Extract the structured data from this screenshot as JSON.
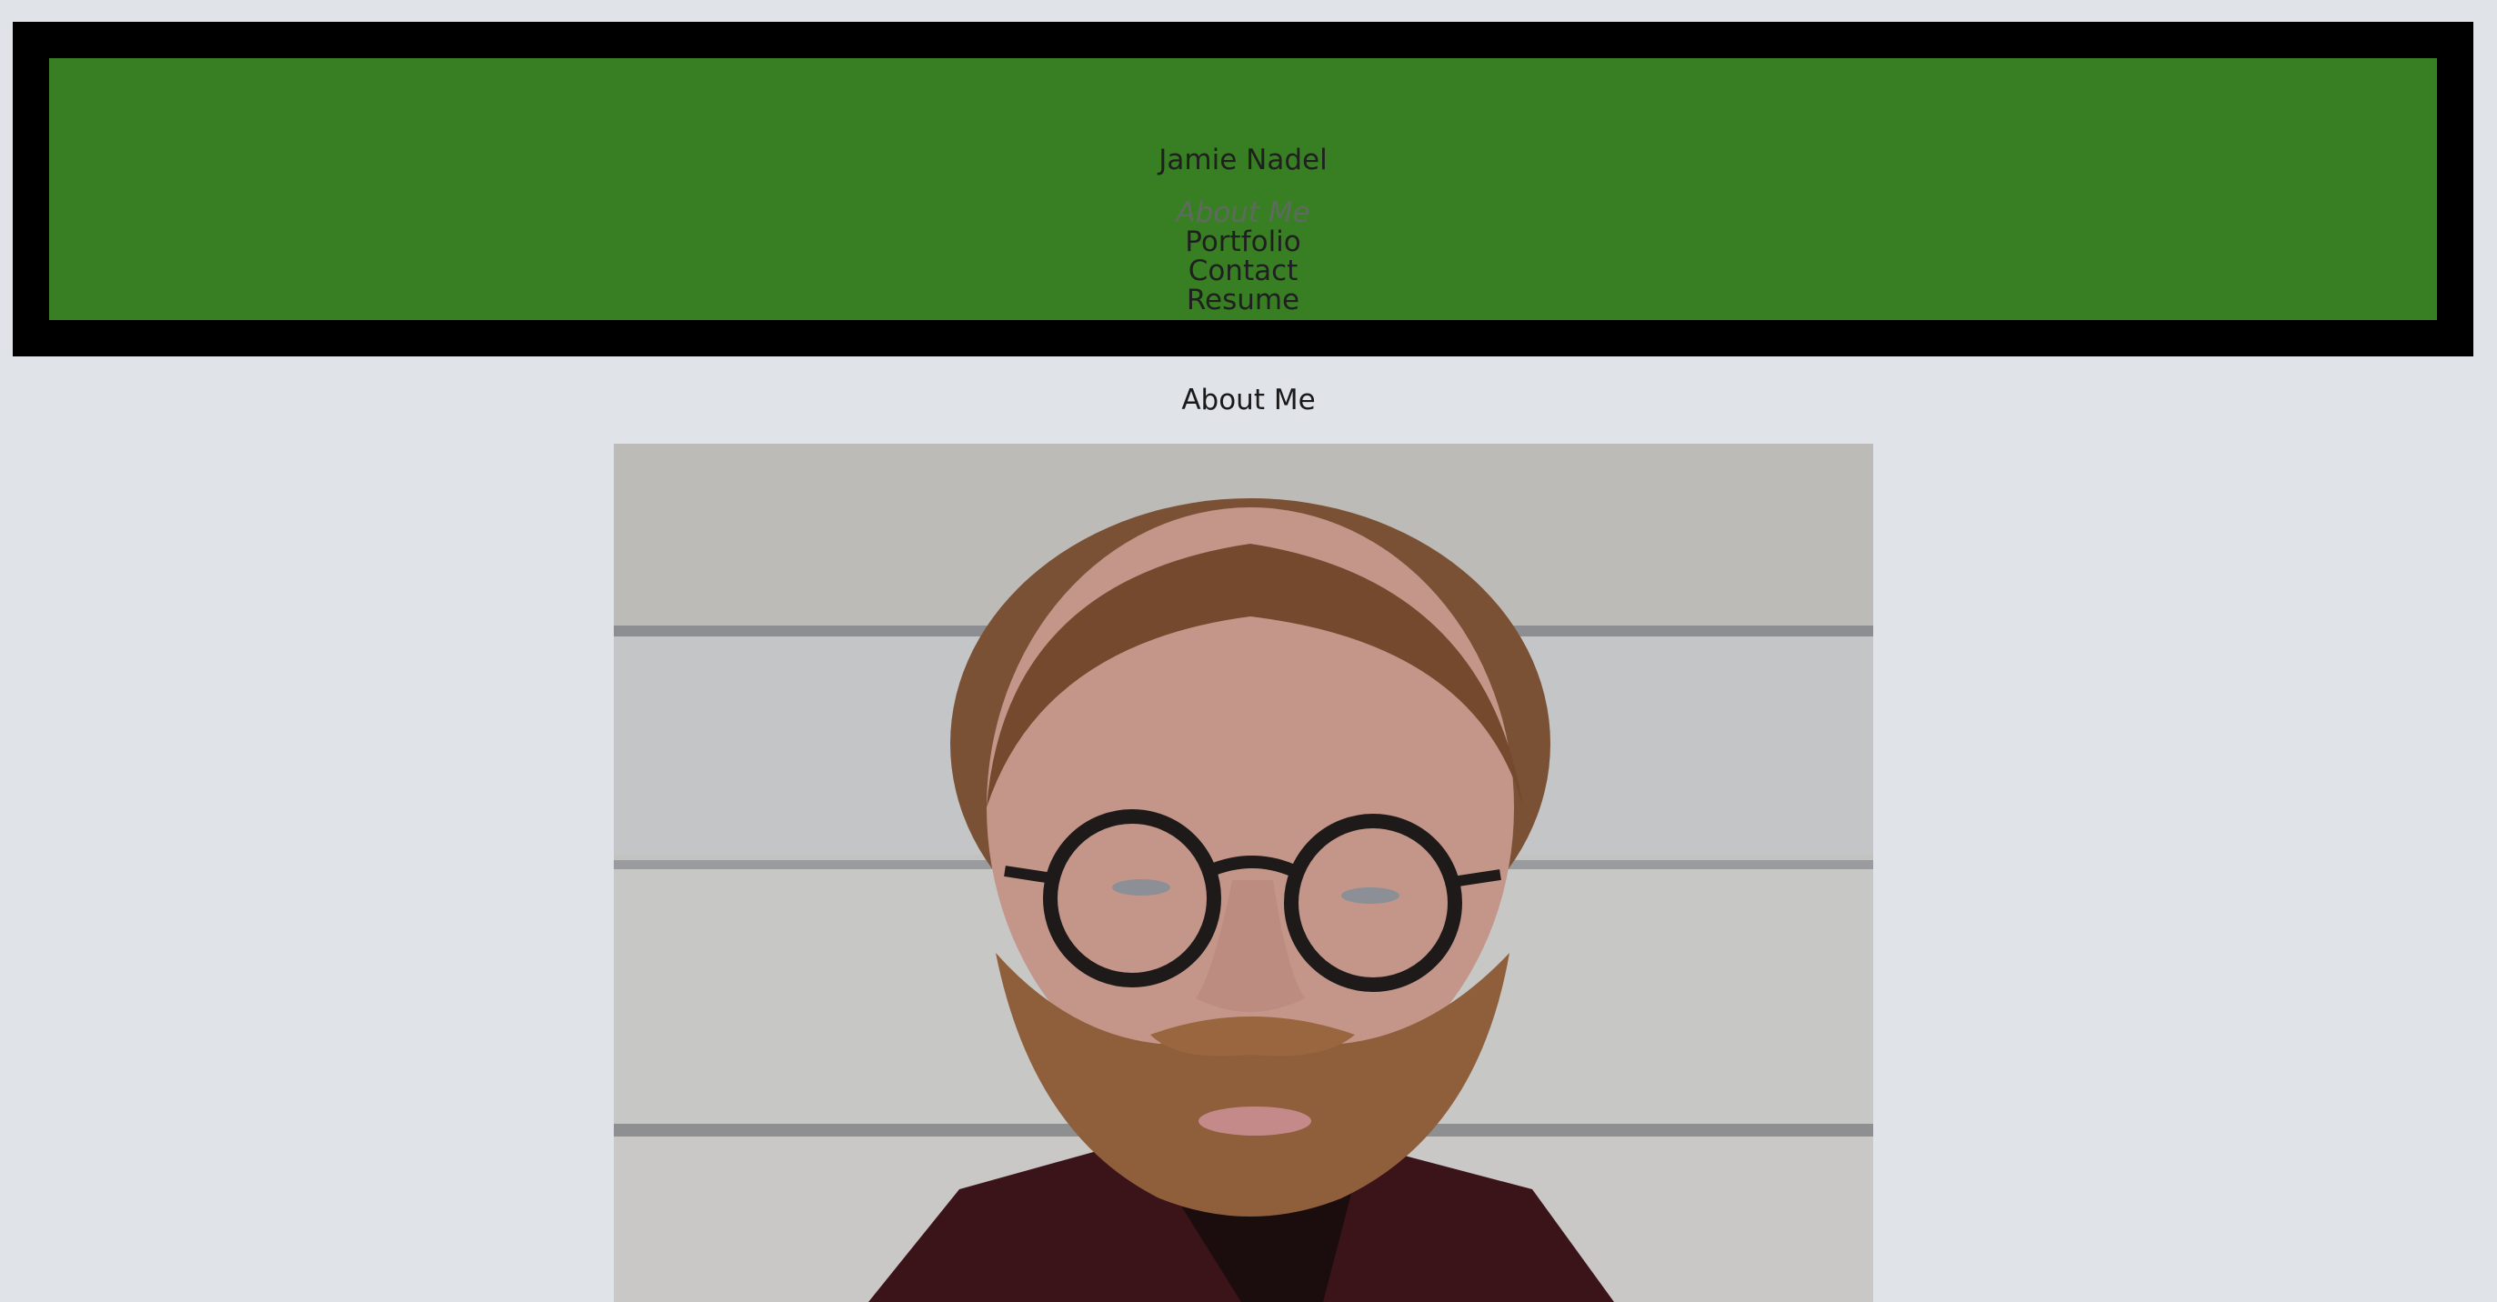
{
  "header": {
    "site_title": "Jamie Nadel",
    "nav": [
      {
        "label": "About Me",
        "active": true
      },
      {
        "label": "Portfolio",
        "active": false
      },
      {
        "label": "Contact",
        "active": false
      },
      {
        "label": "Resume",
        "active": false
      }
    ]
  },
  "main": {
    "section_title": "About Me"
  },
  "colors": {
    "page_background": "#e0e3e8",
    "header_border": "#000000",
    "header_background": "#387f23",
    "active_nav": "#5f6a5e"
  }
}
